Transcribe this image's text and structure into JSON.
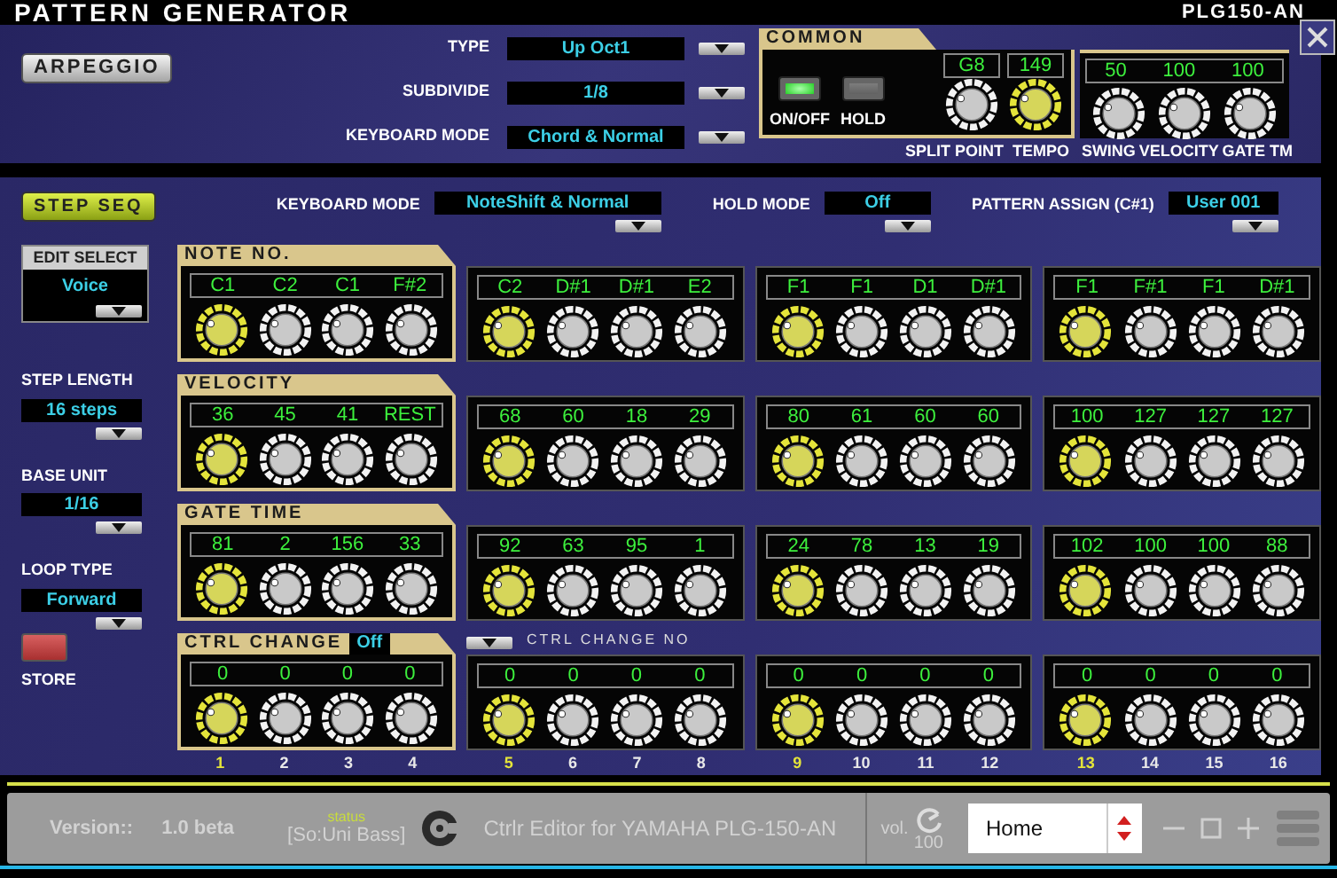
{
  "title": "PATTERN GENERATOR",
  "logo": "PLG150-AN",
  "arpeggio": {
    "button": "ARPEGGIO",
    "fields": [
      {
        "label": "TYPE",
        "value": "Up Oct1"
      },
      {
        "label": "SUBDIVIDE",
        "value": "1/8"
      },
      {
        "label": "KEYBOARD MODE",
        "value": "Chord & Normal"
      }
    ]
  },
  "common": {
    "title": "COMMON",
    "switches": [
      {
        "label": "ON/OFF",
        "on": true
      },
      {
        "label": "HOLD",
        "on": false
      }
    ],
    "knobs_left": [
      {
        "label": "SPLIT POINT",
        "value": "G8",
        "highlighted": false
      },
      {
        "label": "TEMPO",
        "value": "149",
        "highlighted": true
      }
    ],
    "knobs_right": [
      {
        "label": "SWING",
        "value": "50",
        "highlighted": false
      },
      {
        "label": "VELOCITY",
        "value": "100",
        "highlighted": false
      },
      {
        "label": "GATE TM",
        "value": "100",
        "highlighted": false
      }
    ]
  },
  "step_seq": {
    "button": "STEP SEQ",
    "fields": [
      {
        "label": "KEYBOARD MODE",
        "value": "NoteShift & Normal"
      },
      {
        "label": "HOLD MODE",
        "value": "Off"
      },
      {
        "label": "PATTERN ASSIGN (C#1)",
        "value": "User 001"
      }
    ],
    "edit_select": {
      "label": "EDIT SELECT",
      "value": "Voice"
    },
    "side_fields": [
      {
        "label": "STEP LENGTH",
        "value": "16 steps"
      },
      {
        "label": "BASE UNIT",
        "value": "1/16"
      },
      {
        "label": "LOOP TYPE",
        "value": "Forward"
      }
    ],
    "store": {
      "label": "STORE"
    },
    "rows": [
      {
        "kind": "plain",
        "title": "NOTE NO.",
        "cells": [
          {
            "value": "C1"
          },
          {
            "value": "C2"
          },
          {
            "value": "C1"
          },
          {
            "value": "F#2"
          },
          {
            "value": "C2"
          },
          {
            "value": "D#1"
          },
          {
            "value": "D#1"
          },
          {
            "value": "E2"
          },
          {
            "value": "F1"
          },
          {
            "value": "F1"
          },
          {
            "value": "D1"
          },
          {
            "value": "D#1"
          },
          {
            "value": "F1"
          },
          {
            "value": "F#1"
          },
          {
            "value": "F1"
          },
          {
            "value": "D#1"
          }
        ]
      },
      {
        "kind": "plain",
        "title": "VELOCITY",
        "cells": [
          {
            "value": "36"
          },
          {
            "value": "45"
          },
          {
            "value": "41"
          },
          {
            "value": "REST"
          },
          {
            "value": "68"
          },
          {
            "value": "60"
          },
          {
            "value": "18"
          },
          {
            "value": "29"
          },
          {
            "value": "80"
          },
          {
            "value": "61"
          },
          {
            "value": "60"
          },
          {
            "value": "60"
          },
          {
            "value": "100"
          },
          {
            "value": "127"
          },
          {
            "value": "127"
          },
          {
            "value": "127"
          }
        ]
      },
      {
        "kind": "plain",
        "title": "GATE TIME",
        "cells": [
          {
            "value": "81"
          },
          {
            "value": "2"
          },
          {
            "value": "156"
          },
          {
            "value": "33"
          },
          {
            "value": "92"
          },
          {
            "value": "63"
          },
          {
            "value": "95"
          },
          {
            "value": "1"
          },
          {
            "value": "24"
          },
          {
            "value": "78"
          },
          {
            "value": "13"
          },
          {
            "value": "19"
          },
          {
            "value": "102"
          },
          {
            "value": "100"
          },
          {
            "value": "100"
          },
          {
            "value": "88"
          }
        ]
      },
      {
        "kind": "controller",
        "title": "CTRL CHANGE",
        "mode": "Off",
        "number_label": "CTRL CHANGE NO",
        "cells": [
          {
            "value": "0"
          },
          {
            "value": "0"
          },
          {
            "value": "0"
          },
          {
            "value": "0"
          },
          {
            "value": "0"
          },
          {
            "value": "0"
          },
          {
            "value": "0"
          },
          {
            "value": "0"
          },
          {
            "value": "0"
          },
          {
            "value": "0"
          },
          {
            "value": "0"
          },
          {
            "value": "0"
          },
          {
            "value": "0"
          },
          {
            "value": "0"
          },
          {
            "value": "0"
          },
          {
            "value": "0"
          }
        ]
      }
    ],
    "steps": [
      {
        "number": "1",
        "highlighted": true
      },
      {
        "number": "2",
        "highlighted": false
      },
      {
        "number": "3",
        "highlighted": false
      },
      {
        "number": "4",
        "highlighted": false
      },
      {
        "number": "5",
        "highlighted": true
      },
      {
        "number": "6",
        "highlighted": false
      },
      {
        "number": "7",
        "highlighted": false
      },
      {
        "number": "8",
        "highlighted": false
      },
      {
        "number": "9",
        "highlighted": true
      },
      {
        "number": "10",
        "highlighted": false
      },
      {
        "number": "11",
        "highlighted": false
      },
      {
        "number": "12",
        "highlighted": false
      },
      {
        "number": "13",
        "highlighted": true
      },
      {
        "number": "14",
        "highlighted": false
      },
      {
        "number": "15",
        "highlighted": false
      },
      {
        "number": "16",
        "highlighted": false
      }
    ]
  },
  "status_bar": {
    "version_label": "Version::",
    "version": "1.0 beta",
    "status_label": "status",
    "status": "[So:Uni Bass]",
    "app_title": "Ctrlr Editor for YAMAHA PLG-150-AN",
    "vol_label": "vol.",
    "vol": "100",
    "page": "Home"
  }
}
